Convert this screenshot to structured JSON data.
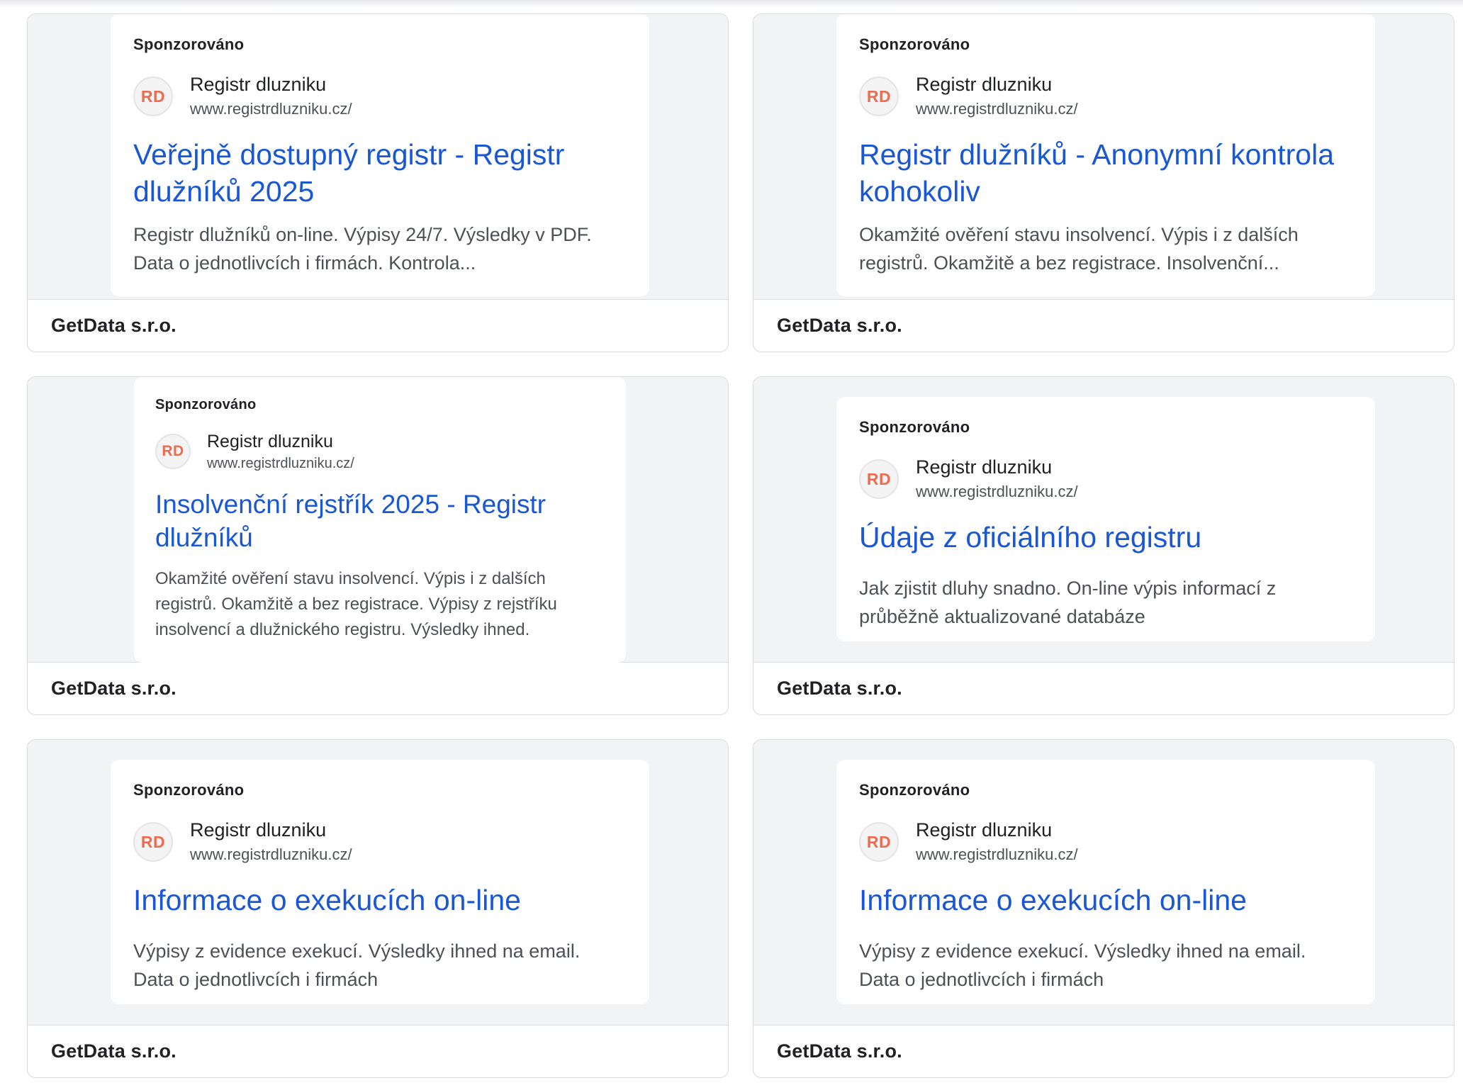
{
  "cards": [
    {
      "sponsored": "Sponzorováno",
      "logo": "RD",
      "site_name": "Registr dluzniku",
      "site_url": "www.registrdluzniku.cz/",
      "headline": "Veřejně dostupný registr - Registr\ndlužníků 2025",
      "description": "Registr dlužníků on-line. Výpisy 24/7. Výsledky v PDF.\nData o jednotlivcích i firmách. Kontrola...",
      "advertiser": "GetData s.r.o."
    },
    {
      "sponsored": "Sponzorováno",
      "logo": "RD",
      "site_name": "Registr dluzniku",
      "site_url": "www.registrdluzniku.cz/",
      "headline": "Registr dlužníků - Anonymní kontrola\nkohokoliv",
      "description": "Okamžité ověření stavu insolvencí. Výpis i z dalších\nregistrů. Okamžitě a bez registrace. Insolvenční...",
      "advertiser": "GetData s.r.o."
    },
    {
      "sponsored": "Sponzorováno",
      "logo": "RD",
      "site_name": "Registr dluzniku",
      "site_url": "www.registrdluzniku.cz/",
      "headline": "Insolvenční rejstřík 2025 - Registr\ndlužníků",
      "description": "Okamžité ověření stavu insolvencí. Výpis i z dalších\nregistrů. Okamžitě a bez registrace. Výpisy z rejstříku\ninsolvencí a dlužnického registru. Výsledky ihned.",
      "advertiser": "GetData s.r.o."
    },
    {
      "sponsored": "Sponzorováno",
      "logo": "RD",
      "site_name": "Registr dluzniku",
      "site_url": "www.registrdluzniku.cz/",
      "headline": "Údaje z oficiálního registru",
      "description": "Jak zjistit dluhy snadno. On-line výpis informací z\nprůběžně aktualizované databáze",
      "advertiser": "GetData s.r.o."
    },
    {
      "sponsored": "Sponzorováno",
      "logo": "RD",
      "site_name": "Registr dluzniku",
      "site_url": "www.registrdluzniku.cz/",
      "headline": "Informace o exekucích on-line",
      "description": "Výpisy z evidence exekucí. Výsledky ihned na email.\nData o jednotlivcích i firmách",
      "advertiser": "GetData s.r.o."
    },
    {
      "sponsored": "Sponzorováno",
      "logo": "RD",
      "site_name": "Registr dluzniku",
      "site_url": "www.registrdluzniku.cz/",
      "headline": "Informace o exekucích on-line",
      "description": "Výpisy z evidence exekucí. Výsledky ihned na email.\nData o jednotlivcích i firmách",
      "advertiser": "GetData s.r.o."
    }
  ]
}
